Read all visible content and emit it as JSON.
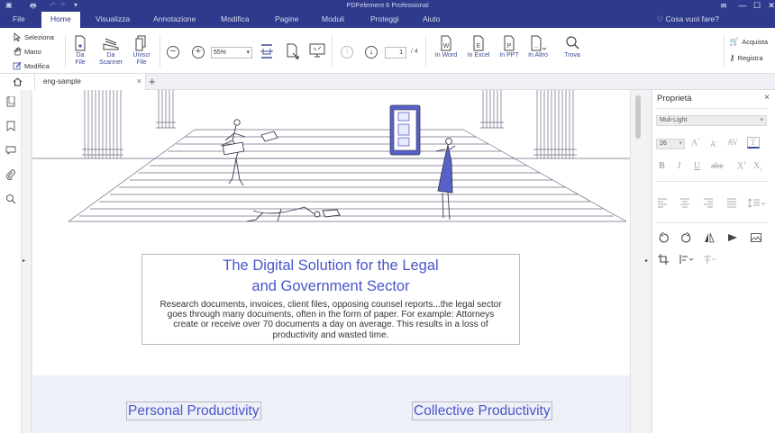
{
  "app": {
    "title": "PDFelement 6 Professional"
  },
  "window": {
    "minimize": "—",
    "maximize": "☐",
    "close": "✕"
  },
  "menu": {
    "items": [
      "File",
      "Home",
      "Visualizza",
      "Annotazione",
      "Modifica",
      "Pagine",
      "Moduli",
      "Proteggi",
      "Aiuto"
    ],
    "active": "Home",
    "help": "Cosa vuoi fare?"
  },
  "ribbon": {
    "select": "Seleziona",
    "hand": "Mano",
    "edit": "Modifica",
    "from_file": "Da File",
    "from_scanner_1": "Da",
    "from_scanner_2": "Scanner",
    "merge_1": "Unisci",
    "merge_2": "File",
    "zoom": "55%",
    "page_current": "1",
    "page_total": "/ 4",
    "to_word": "In Word",
    "to_excel": "In Excel",
    "to_ppt": "In PPT",
    "to_other": "In Altro",
    "find": "Trova",
    "buy": "Acquista",
    "register": "Registra"
  },
  "tabs": {
    "doc_name": "eng-sample",
    "close": "×",
    "new": "+"
  },
  "document": {
    "headline_1": "The Digital Solution for the Legal",
    "headline_2": "and Government Sector",
    "body_1": "Research documents, invoices, client files, opposing counsel reports...the legal sector",
    "body_2": "goes through many documents, often in the form of paper. For example: Attorneys",
    "body_3": "create or receive over 70 documents a day on average. This results in a loss of",
    "body_4": "productivity and wasted time.",
    "sub_left": "Personal Productivity",
    "sub_right": "Collective Productivity"
  },
  "properties": {
    "title": "Proprietà",
    "close": "×",
    "font": "Muli-Light",
    "size": "26"
  },
  "colors": {
    "brand": "#2e3a8c",
    "accent": "#4a55c9"
  }
}
